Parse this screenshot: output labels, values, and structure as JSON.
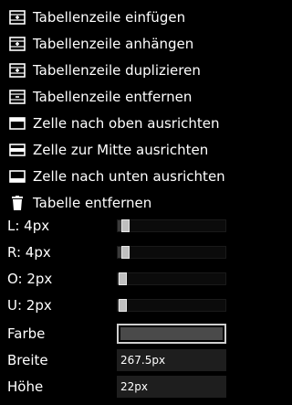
{
  "menu": [
    {
      "label": "Tabellenzeile einfügen",
      "icon": "table-row-insert-icon"
    },
    {
      "label": "Tabellenzeile anhängen",
      "icon": "table-row-append-icon"
    },
    {
      "label": "Tabellenzeile duplizieren",
      "icon": "table-row-duplicate-icon"
    },
    {
      "label": "Tabellenzeile entfernen",
      "icon": "table-row-remove-icon"
    },
    {
      "label": "Zelle nach oben ausrichten",
      "icon": "align-top-icon"
    },
    {
      "label": "Zelle zur Mitte ausrichten",
      "icon": "align-middle-icon"
    },
    {
      "label": "Zelle nach unten ausrichten",
      "icon": "align-bottom-icon"
    },
    {
      "label": "Tabelle entfernen",
      "icon": "trash-icon"
    }
  ],
  "padding": {
    "left": {
      "label": "L: 4px",
      "value": 4
    },
    "right": {
      "label": "R: 4px",
      "value": 4
    },
    "top": {
      "label": "O: 2px",
      "value": 2
    },
    "bottom": {
      "label": "U: 2px",
      "value": 2
    }
  },
  "color": {
    "label": "Farbe",
    "value": "#4a4a4a"
  },
  "width": {
    "label": "Breite",
    "value": "267.5px"
  },
  "height": {
    "label": "Höhe",
    "value": "22px"
  }
}
